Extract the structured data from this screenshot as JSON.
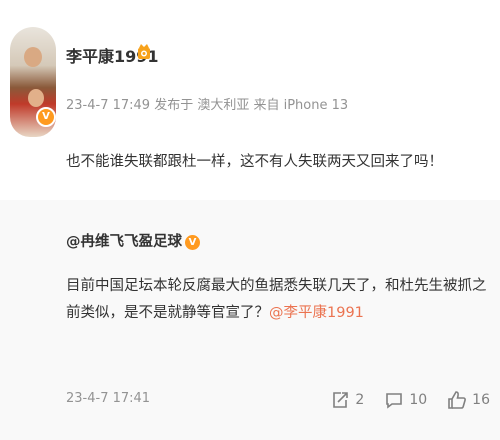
{
  "post": {
    "username": "李平康1991",
    "meta": "23-4-7 17:49  发布于 澳大利亚  来自 iPhone 13",
    "text": "也不能谁失联都跟杜一样，这不有人失联两天又回来了吗！",
    "verified_mark": "V"
  },
  "repost": {
    "author": "@冉维飞飞盈足球",
    "verified_mark": "V",
    "body": "目前中国足坛本轮反腐最大的鱼据悉失联几天了，和杜先生被抓之前类似，是不是就静等官宣了？",
    "mention": "@李平康1991",
    "time": "23-4-7 17:41",
    "actions": {
      "repost_count": "2",
      "comment_count": "10",
      "like_count": "16"
    }
  }
}
